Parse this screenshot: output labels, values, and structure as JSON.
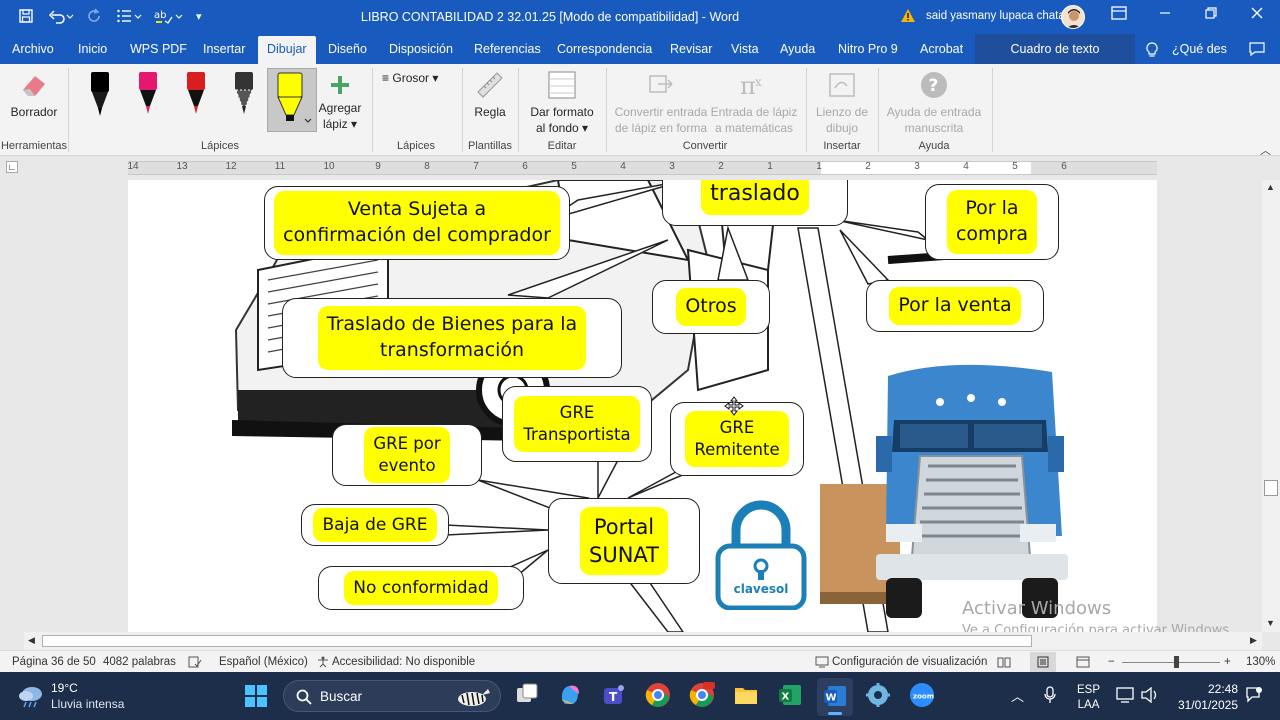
{
  "window": {
    "title": "LIBRO CONTABILIDAD 2 32.01.25 [Modo de compatibilidad] - Word",
    "user": "said yasmany lupaca chata"
  },
  "tabs": [
    "Archivo",
    "Inicio",
    "WPS PDF",
    "Insertar",
    "Dibujar",
    "Diseño",
    "Disposición",
    "Referencias",
    "Correspondencia",
    "Revisar",
    "Vista",
    "Ayuda",
    "Nitro Pro 9",
    "Acrobat"
  ],
  "active_tab": "Dibujar",
  "context_tab": "Cuadro de texto",
  "tell_me": "¿Qué des",
  "ribbon": {
    "eraser": "Borrador",
    "add_pen_1": "Agregar",
    "add_pen_2": "lápiz",
    "thickness": "Grosor",
    "ruler": "Regla",
    "format_bg_1": "Dar formato",
    "format_bg_2": "al fondo",
    "convert_shape_1": "Convertir entrada",
    "convert_shape_2": "de lápiz en forma",
    "convert_math_1": "Entrada de lápiz",
    "convert_math_2": "a matemáticas",
    "canvas_1": "Lienzo de",
    "canvas_2": "dibujo",
    "help_ink_1": "Ayuda de entrada",
    "help_ink_2": "manuscrita",
    "groups": {
      "tools": "Herramientas",
      "pens": "Lápices",
      "pens2": "Lápices",
      "stencils": "Plantillas",
      "edit": "Editar",
      "convert": "Convertir",
      "insert": "Insertar",
      "help": "Ayuda"
    },
    "pen_colors": [
      "#000000",
      "#e5176e",
      "#d81e1e",
      "#333333",
      "#ffff00"
    ]
  },
  "ruler_numbers": [
    "14",
    "13",
    "12",
    "11",
    "10",
    "9",
    "8",
    "7",
    "6",
    "5",
    "4",
    "3",
    "2",
    "1",
    "1",
    "2",
    "3",
    "4",
    "5",
    "6"
  ],
  "document": {
    "bubbles": {
      "venta_sujeta_1": "Venta Sujeta a",
      "venta_sujeta_2": "confirmación del comprador",
      "traslado": "traslado",
      "por_la_compra_1": "Por la",
      "por_la_compra_2": "compra",
      "otros": "Otros",
      "por_la_venta": "Por la venta",
      "traslado_bienes_1": "Traslado de Bienes para la",
      "traslado_bienes_2": "transformación",
      "gre_transportista_1": "GRE",
      "gre_transportista_2": "Transportista",
      "gre_remitente_1": "GRE",
      "gre_remitente_2": "Remitente",
      "gre_evento_1": "GRE por",
      "gre_evento_2": "evento",
      "baja_gre": "Baja de GRE",
      "portal_1": "Portal",
      "portal_2": "SUNAT",
      "no_conformidad": "No conformidad"
    },
    "lock_label": "clavesol",
    "watermark_1": "Activar Windows",
    "watermark_2": "Ve a Configuración para activar Windows."
  },
  "statusbar": {
    "page": "Página 36 de 50",
    "words": "4082 palabras",
    "language": "Español (México)",
    "accessibility": "Accesibilidad: No disponible",
    "display_settings": "Configuración de visualización",
    "zoom": "130%",
    "zoom_level": 0.55
  },
  "taskbar": {
    "temp": "19°C",
    "weather": "Lluvia intensa",
    "search_placeholder": "Buscar",
    "lang_1": "ESP",
    "lang_2": "LAA",
    "time": "22:48",
    "date": "31/01/2025"
  }
}
